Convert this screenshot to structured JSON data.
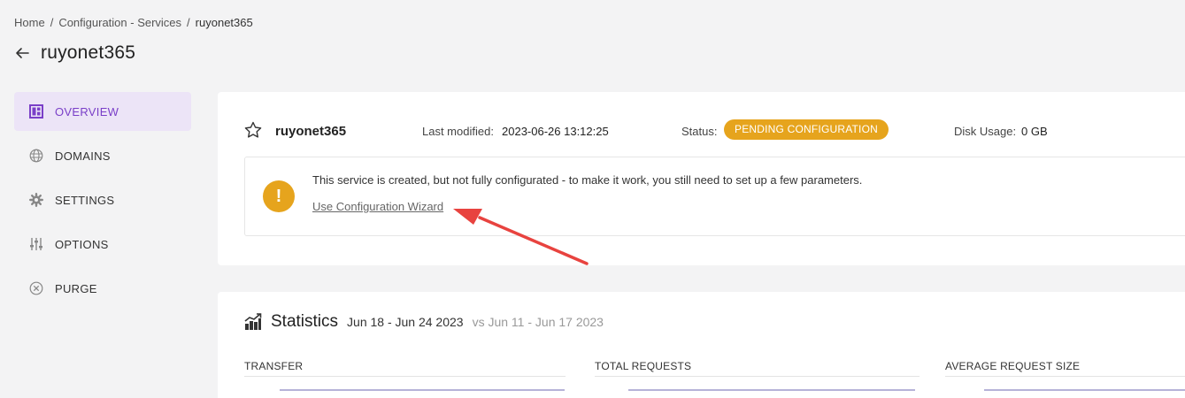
{
  "breadcrumb": {
    "home": "Home",
    "sep": "/",
    "section": "Configuration - Services",
    "current": "ruyonet365"
  },
  "page": {
    "title": "ruyonet365"
  },
  "sidebar": {
    "items": [
      {
        "label": "OVERVIEW",
        "icon": "dashboard-icon",
        "active": true
      },
      {
        "label": "DOMAINS",
        "icon": "globe-icon"
      },
      {
        "label": "SETTINGS",
        "icon": "gear-icon"
      },
      {
        "label": "OPTIONS",
        "icon": "sliders-icon"
      },
      {
        "label": "PURGE",
        "icon": "circle-x-icon"
      }
    ]
  },
  "service": {
    "name": "ruyonet365",
    "last_modified_label": "Last modified:",
    "last_modified": "2023-06-26 13:12:25",
    "status_label": "Status:",
    "status": "PENDING CONFIGURATION",
    "disk_label": "Disk Usage:",
    "disk": "0 GB"
  },
  "alert": {
    "icon": "!",
    "message": "This service is created, but not fully configurated - to make it work, you still need to set up a few parameters.",
    "link": "Use Configuration Wizard"
  },
  "statistics": {
    "title": "Statistics",
    "range": "Jun 18 - Jun 24 2023",
    "compare": "vs Jun 11 - Jun 17 2023",
    "metrics": [
      "TRANSFER",
      "TOTAL REQUESTS",
      "AVERAGE REQUEST SIZE"
    ]
  },
  "colors": {
    "accent": "#7a3fc8",
    "accent_bg": "#ece4f7",
    "warning": "#e6a41d",
    "annotation": "#e8433f"
  }
}
